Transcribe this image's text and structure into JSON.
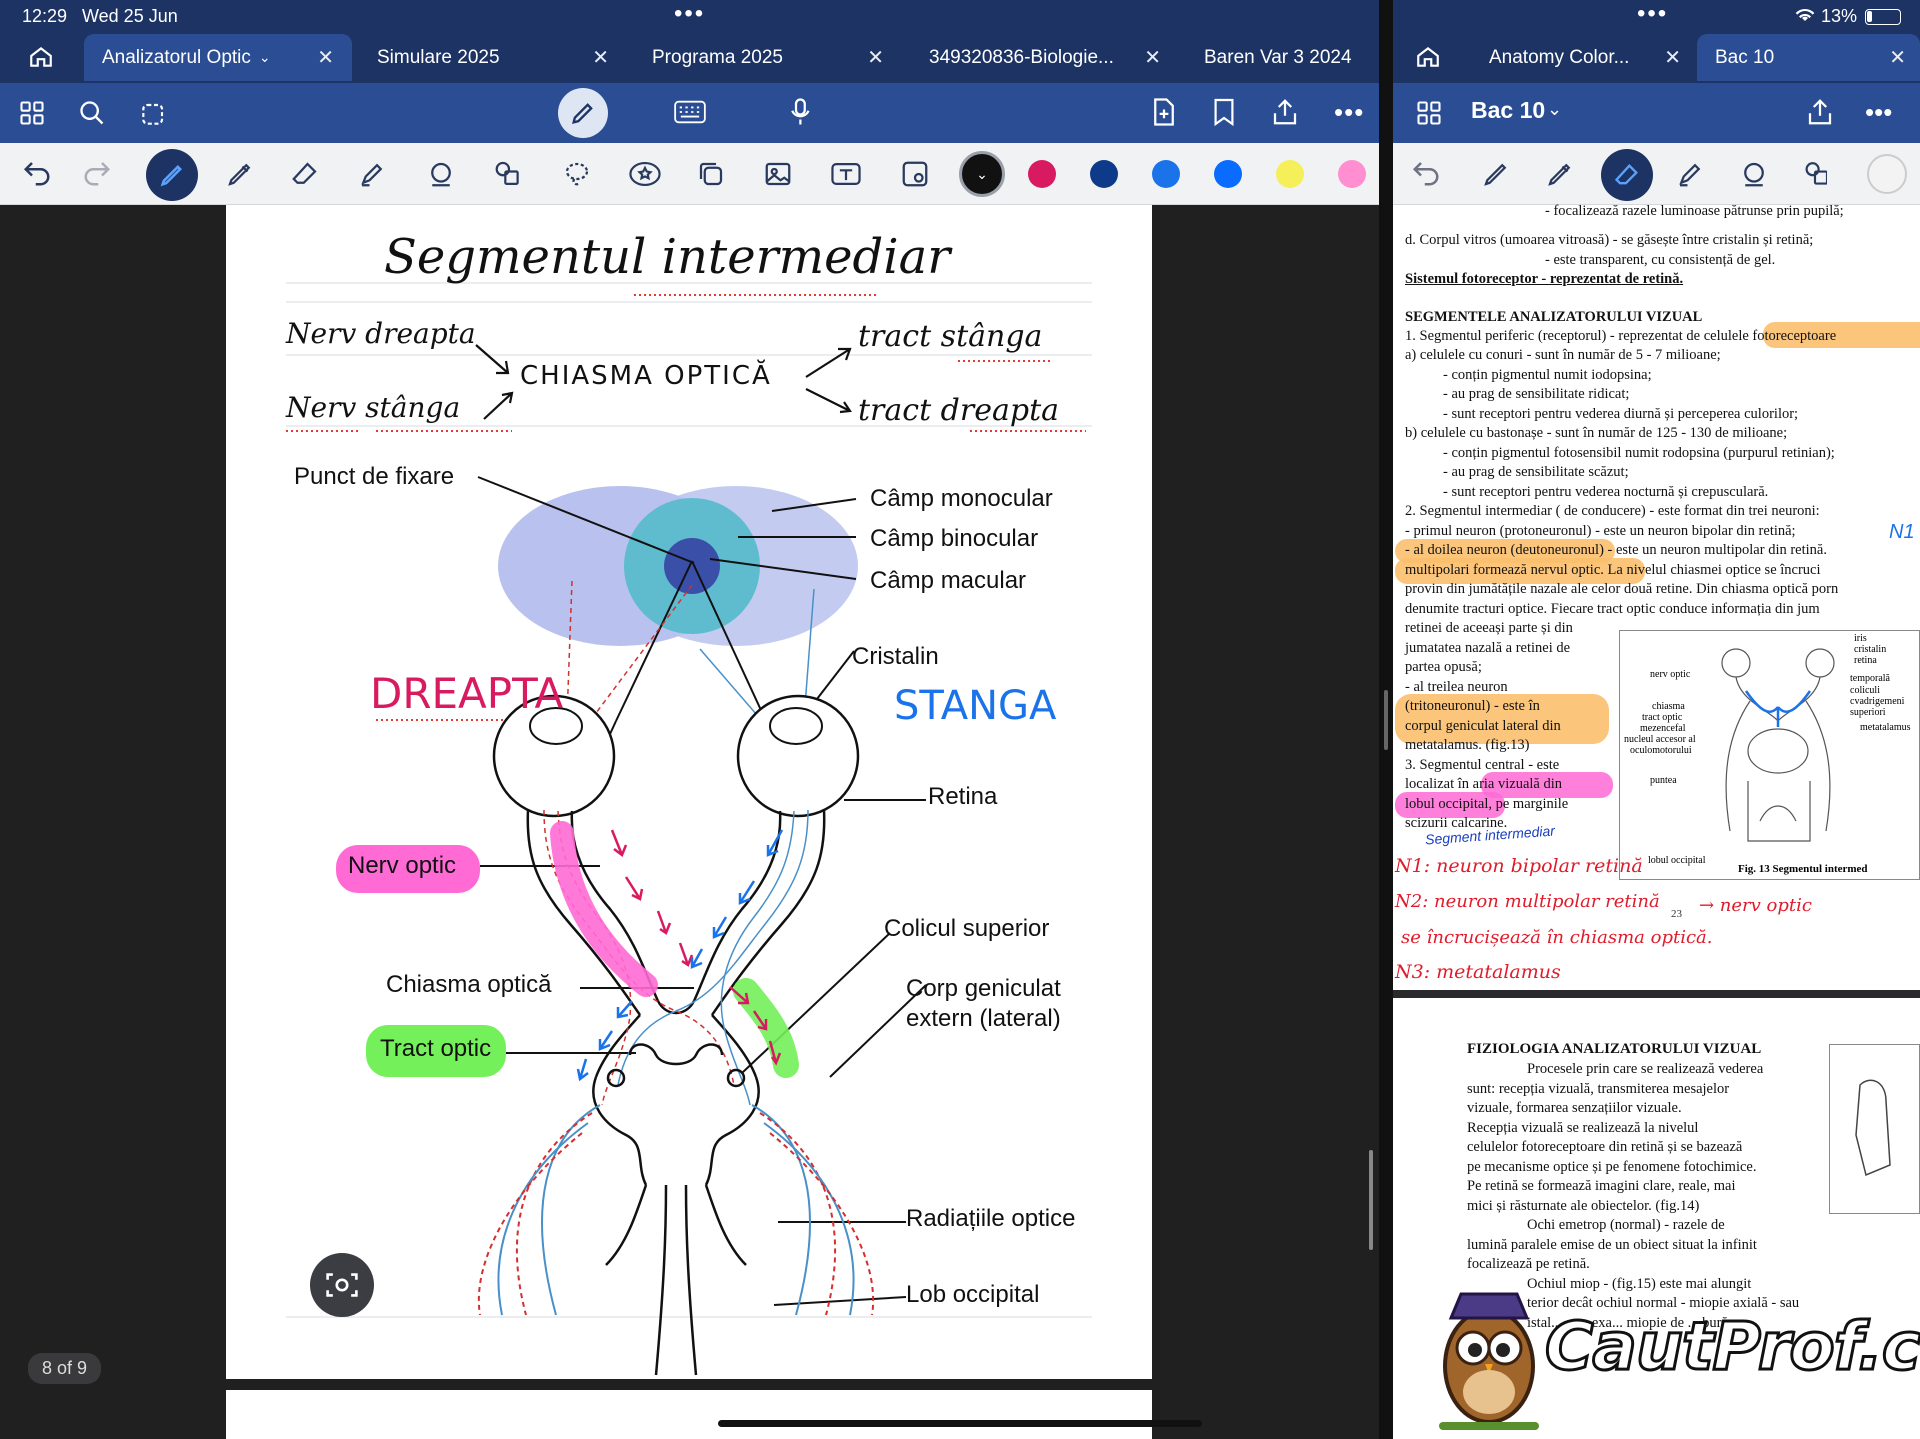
{
  "status": {
    "time": "12:29",
    "date": "Wed 25 Jun",
    "battery": "13%"
  },
  "left": {
    "tabs": [
      {
        "label": "Analizatorul Optic",
        "active": true
      },
      {
        "label": "Simulare 2025"
      },
      {
        "label": "Programa 2025"
      },
      {
        "label": "349320836-Biologie..."
      },
      {
        "label": "Baren Var 3 2024"
      }
    ],
    "note": {
      "title": "Segmentul intermediar",
      "row1_left": "Nerv dreapta",
      "row2_left": "Nerv stânga",
      "center": "CHIASMA OPTICĂ",
      "row1_right": "tract stânga",
      "row2_right": "tract dreapta",
      "side_left": "DREAPTA",
      "side_right": "STANGA"
    },
    "diagram": {
      "punct_fixare": "Punct de fixare",
      "camp_monocular": "Câmp monocular",
      "camp_binocular": "Câmp binocular",
      "camp_macular": "Câmp macular",
      "cristalin": "Cristalin",
      "retina": "Retina",
      "nerv_optic": "Nerv optic",
      "colicul": "Colicul superior",
      "chiasma": "Chiasma optică",
      "corp_geniculat_1": "Corp geniculat",
      "corp_geniculat_2": "extern (lateral)",
      "tract_optic": "Tract optic",
      "radiatii": "Radiațiile optice",
      "lob": "Lob occipital"
    },
    "page_counter": "8 of 9",
    "colors": {
      "pen_blue": "#1a73e8",
      "pen_red": "#d81b60",
      "highlight_pink": "#ff6ad5",
      "highlight_green": "#74f05a"
    }
  },
  "right": {
    "tabs": [
      {
        "label": "Anatomy Color..."
      },
      {
        "label": "Bac 10",
        "active": true
      }
    ],
    "doc_title": "Bac 10",
    "doc_lines": [
      "- focalizează razele luminoase pătrunse prin pupilă;",
      "d. Corpul vitros (umoarea vitroasă) - se găsește între cristalin și retină;",
      "- este transparent, cu consistență de gel.",
      "Sistemul fotoreceptor - reprezentat de retină.",
      "SEGMENTELE ANALIZATORULUI VIZUAL",
      "1. Segmentul periferic (receptorul) - reprezentat de celulele fotoreceptoare",
      "a) celulele cu conuri - sunt în număr de 5 - 7 milioane;",
      "- conțin pigmentul numit iodopsina;",
      "- au prag de sensibilitate ridicat;",
      "- sunt receptori pentru vederea diurnă și perceperea culorilor;",
      "b) celulele cu bastonașe - sunt în număr de 125 - 130 de milioane;",
      "- conțin pigmentul fotosensibil numit rodopsina (purpurul retinian);",
      "- au prag de sensibilitate scăzut;",
      "- sunt receptori pentru vederea nocturnă și crepusculară.",
      "2. Segmentul intermediar ( de conducere) - este format din trei neuroni:",
      "- primul neuron (protoneuronul) - este un neuron bipolar din retină;",
      "- al doilea neuron (deutoneuronul) - este un neuron multipolar din retină.",
      "multipolari formează nervul optic. La nivelul chiasmei optice se încruci",
      "provin din jumătățile nazale ale celor două retine. Din chiasma optică porn",
      "denumite tracturi optice. Fiecare tract optic conduce informația din jum",
      "retinei de aceeași parte și din",
      "jumatatea nazală a retinei de",
      "partea opusă;",
      "- al treilea neuron",
      "(tritoneuronul) - este în",
      "corpul geniculat lateral din",
      "metatalamus. (fig.13)",
      "3. Segmentul central - este",
      "localizat în aria vizuală din",
      "lobul occipital, pe marginile",
      "scizurii calcarine."
    ],
    "fig_caption": "Fig. 13 Segmentul intermed",
    "fig_labels": [
      "iris",
      "cristalin",
      "retina",
      "temporală",
      "coliculi",
      "cvadrigemeni",
      "superiori",
      "metatalamus",
      "nerv optic",
      "chiasma",
      "tract optic",
      "mezencefal",
      "nucleul accesor al",
      "oculomotorului",
      "puntea",
      "lobul occipital"
    ],
    "hand_notes": {
      "title": "Segment intermediar",
      "n1": "N1: neuron bipolar retină",
      "n2a": "N2: neuron multipolar retină",
      "n2b": "→ nerv optic",
      "n2c": "se încrucișează în chiasma optică.",
      "n3": "N3: metatalamus",
      "n1_side": "N1",
      "page_no": "23"
    },
    "doc2_title": "FIZIOLOGIA ANALIZATORULUI VIZUAL",
    "doc2_lines": [
      "Procesele prin care se realizează vederea",
      "sunt: recepția vizuală, transmiterea mesajelor",
      "vizuale, formarea senzațiilor vizuale.",
      "Recepția vizuală se realizează la nivelul",
      "celulelor fotoreceptoare din retină și se bazează",
      "pe mecanisme optice și pe fenomene fotochimice.",
      "Pe retină se formează imagini clare, reale, mai",
      "mici și răsturnate ale obiectelor. (fig.14)",
      "Ochi emetrop (normal) - razele de",
      "lumină paralele emise de un obiect situat la infinit",
      "focalizează pe retină.",
      "Ochiul miop - (fig.15) este mai alungit",
      "terior decât ochiul normal - miopie axială - sau",
      "istal... este exa... miopie de ... bură,"
    ],
    "watermark": "CautProf.com"
  }
}
